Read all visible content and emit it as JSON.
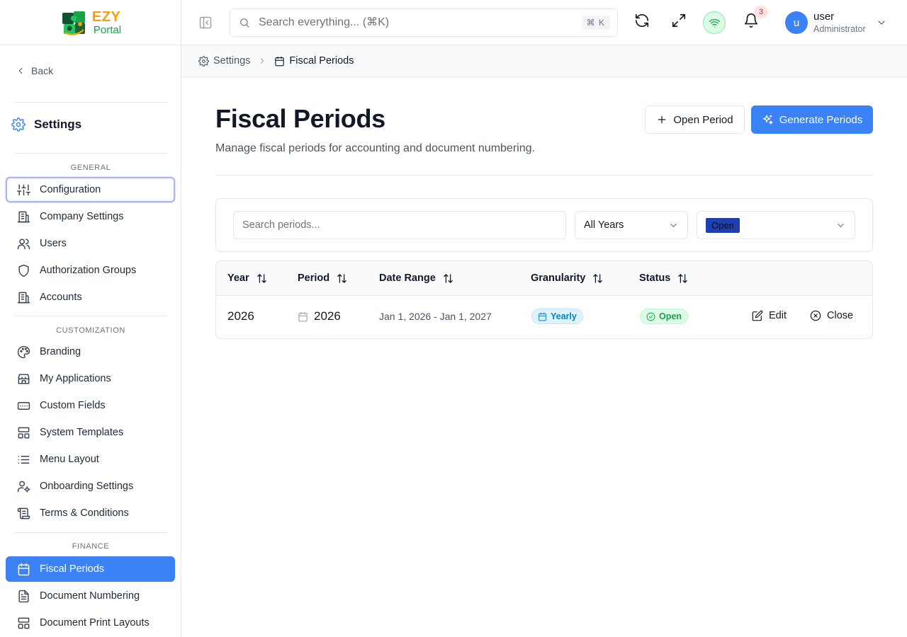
{
  "app": {
    "logo_ezy": "EZY",
    "logo_portal": "Portal"
  },
  "topbar": {
    "search_placeholder": "Search everything... (⌘K)",
    "search_shortcut": "⌘ K",
    "notification_count": "3",
    "user_initial": "u",
    "user_name": "user",
    "user_role": "Administrator",
    "status_color": "#16a34a"
  },
  "sidebar": {
    "back_label": "Back",
    "settings_title": "Settings",
    "sections": {
      "general": "GENERAL",
      "customization": "CUSTOMIZATION",
      "finance": "FINANCE"
    },
    "items": [
      {
        "label": "Configuration",
        "icon": "sliders-icon"
      },
      {
        "label": "Company Settings",
        "icon": "building-icon"
      },
      {
        "label": "Users",
        "icon": "users-icon"
      },
      {
        "label": "Authorization Groups",
        "icon": "shield-icon"
      },
      {
        "label": "Accounts",
        "icon": "building-icon"
      },
      {
        "label": "Branding",
        "icon": "palette-icon"
      },
      {
        "label": "My Applications",
        "icon": "store-icon"
      },
      {
        "label": "Custom Fields",
        "icon": "input-field-icon"
      },
      {
        "label": "System Templates",
        "icon": "layout-icon"
      },
      {
        "label": "Menu Layout",
        "icon": "list-icon"
      },
      {
        "label": "Onboarding Settings",
        "icon": "user-cog-icon"
      },
      {
        "label": "Terms & Conditions",
        "icon": "scroll-icon"
      },
      {
        "label": "Fiscal Periods",
        "icon": "calendar-icon"
      },
      {
        "label": "Document Numbering",
        "icon": "file-text-icon"
      },
      {
        "label": "Document Print Layouts",
        "icon": "layout-icon"
      }
    ],
    "accent_color": "#3b82f6"
  },
  "breadcrumb": {
    "parent": "Settings",
    "current": "Fiscal Periods"
  },
  "page": {
    "title": "Fiscal Periods",
    "subtitle": "Manage fiscal periods for accounting and document numbering.",
    "open_period_label": "Open Period",
    "generate_periods_label": "Generate Periods"
  },
  "filters": {
    "search_placeholder": "Search periods...",
    "year_selected": "All Years",
    "status_selected": "Open"
  },
  "table": {
    "columns": [
      "Year",
      "Period",
      "Date Range",
      "Granularity",
      "Status"
    ],
    "rows": [
      {
        "year": "2026",
        "period": "2026",
        "date_range": "Jan 1, 2026 - Jan 1, 2027",
        "granularity": "Yearly",
        "status": "Open",
        "edit_label": "Edit",
        "close_label": "Close"
      }
    ]
  }
}
